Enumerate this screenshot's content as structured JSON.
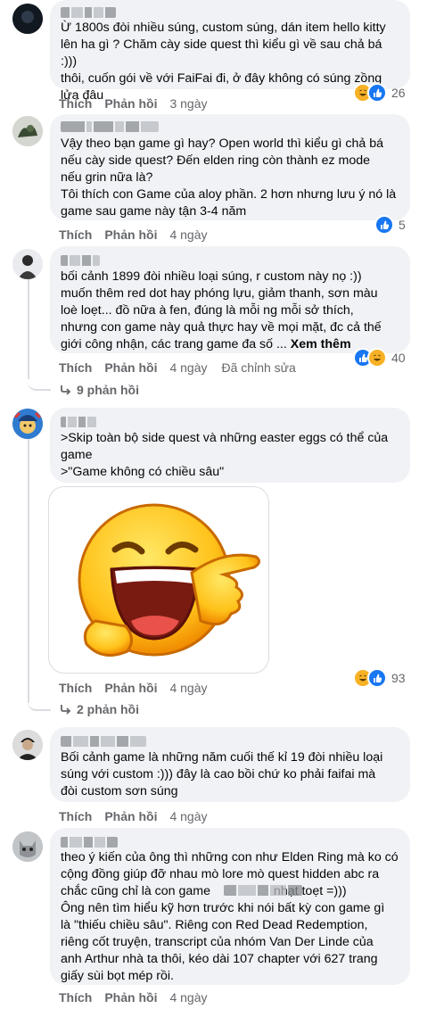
{
  "labels": {
    "like": "Thích",
    "reply": "Phản hồi"
  },
  "comments": [
    {
      "text": "Ừ 1800s đòi nhiều súng, custom súng, dán item hello kitty\nlên ha gì ? Chăm cày side quest thì kiểu gì về sau chả bá :)))\nthôi, cuốn gói về với FaiFai đi, ở đây không có súng zồng\nlửa đâu",
      "time": "3 ngày",
      "reaction_count": "26"
    },
    {
      "text": "Vậy theo bạn game gì hay? Open world thì kiểu gì chả bá\nnếu cày side quest? Đến elden ring còn thành ez mode\nnếu grin nữa là?\nTôi thích con Game của aloy phần. 2 hơn nhưng lưu ý nó là\ngame sau game này tận 3-4 năm",
      "time": "4 ngày",
      "reaction_count": "5"
    },
    {
      "text": "bối cảnh 1899 đòi nhiều loại súng, r custom này nọ :))\nmuốn thêm red dot hay phóng lựu, giảm thanh, sơn màu\nloè loẹt... đồ nữa à fen, đúng là mỗi ng mỗi sở thích,\nnhưng con game này quả thực hay về mọi mặt, đc cả thế\ngiới công nhận, các trang game đa số ...",
      "see_more": "Xem thêm",
      "time": "4 ngày",
      "edited": "Đã chỉnh sửa",
      "reaction_count": "40",
      "replies": "9 phản hồi"
    },
    {
      "text": ">Skip toàn bộ side quest và những easter eggs có thể của\ngame\n>\"Game không có chiều sâu\"",
      "time": "4 ngày",
      "reaction_count": "93",
      "replies": "2 phản hồi"
    },
    {
      "text": "Bối cảnh game là những năm cuối thế kỉ 19 đòi nhiều loại\nsúng với custom :))) đây là cao bồi chứ ko phải faifai mà\nđòi custom sơn súng",
      "time": "4 ngày"
    },
    {
      "text": "theo ý kiến của ông thì những con như Elden Ring mà ko có\ncộng đồng giúp đỡ nhau mò lore mò quest hidden abc ra\nchắc cũng chỉ là con game                  nhạt toẹt =)))\nÔng nên tìm hiểu kỹ hơn trước khi nói bất kỳ con game gì\nlà \"thiếu chiều sâu\". Riêng con Red Dead Redemption,\nriêng cốt truyện, transcript của nhóm Van Der Linde của\nanh Arthur nhà ta thôi, kéo dài 107 chapter với 627 trang\ngiấy sùi bọt mép rồi.",
      "time": "4 ngày"
    }
  ],
  "icons": [
    "like-reaction-icon",
    "haha-reaction-icon",
    "reply-arrow-icon",
    "laughing-emoji-sticker"
  ]
}
